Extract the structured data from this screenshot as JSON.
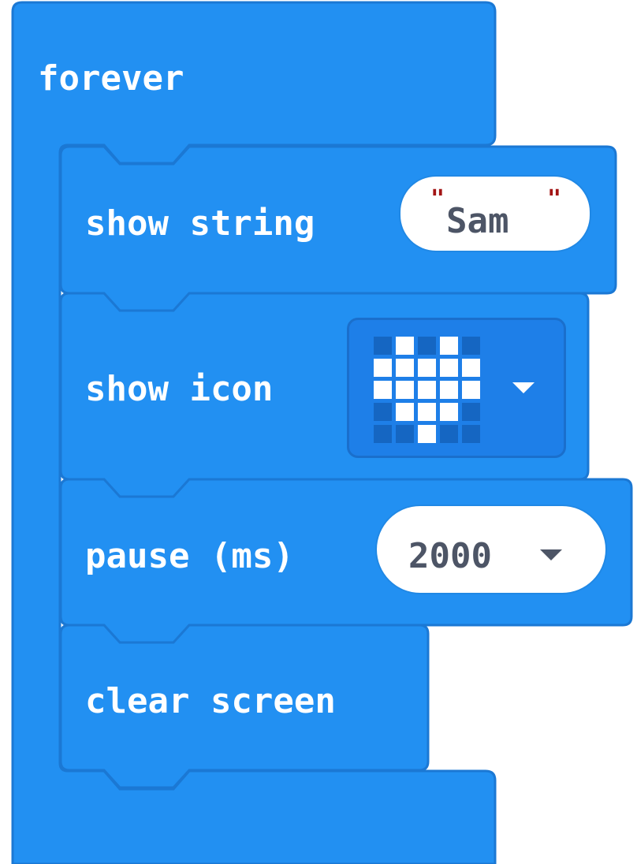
{
  "colors": {
    "block_fill": "#2290F2",
    "block_edge": "#1B78D4",
    "pill_fill": "#FFFFFF",
    "pill_text": "#4D5566",
    "string_quote": "#A31515",
    "led_on": "#FFFFFF",
    "led_off": "#1566C2"
  },
  "forever_block": {
    "label": "forever"
  },
  "blocks": {
    "show_string": {
      "label": "show string",
      "value": "Sam",
      "quote_open": "\"",
      "quote_close": "\""
    },
    "show_icon": {
      "label": "show icon",
      "icon": "heart",
      "leds": [
        [
          0,
          1,
          0,
          1,
          0
        ],
        [
          1,
          1,
          1,
          1,
          1
        ],
        [
          1,
          1,
          1,
          1,
          1
        ],
        [
          0,
          1,
          1,
          1,
          0
        ],
        [
          0,
          0,
          1,
          0,
          0
        ]
      ],
      "dropdown_icon": "caret-down-icon"
    },
    "pause": {
      "label": "pause (ms)",
      "value": "2000",
      "dropdown_icon": "caret-down-icon"
    },
    "clear_screen": {
      "label": "clear screen"
    }
  }
}
